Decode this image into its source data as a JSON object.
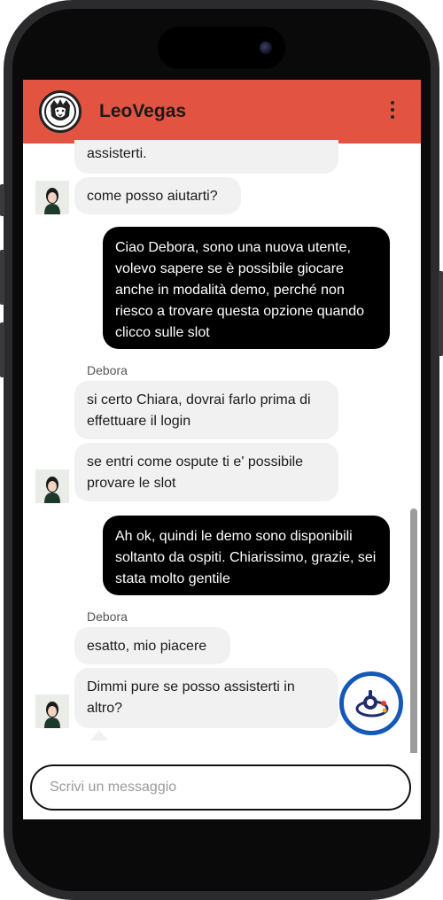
{
  "header": {
    "brand": "LeoVegas",
    "logo_icon": "lion-logo-icon",
    "menu_icon": "kebab-menu-icon",
    "color": "#e25441"
  },
  "messages": [
    {
      "role": "agent",
      "text": "assisterti."
    },
    {
      "role": "agent",
      "text": "come posso aiutarti?"
    },
    {
      "role": "user",
      "text": "Ciao Debora, sono una nuova utente, volevo sapere se è possibile giocare anche in modalità demo, perché non riesco a trovare questa opzione quando clicco sulle slot"
    },
    {
      "role": "sender",
      "text": "Debora"
    },
    {
      "role": "agent",
      "text": "si certo Chiara, dovrai farlo prima di effettuare il login"
    },
    {
      "role": "agent",
      "text": "se entri come ospute ti e' possibile provare le slot"
    },
    {
      "role": "user",
      "text": "Ah ok, quindi le demo sono disponibili soltanto da ospiti. Chiarissimo, grazie, sei stata molto gentile"
    },
    {
      "role": "sender",
      "text": "Debora"
    },
    {
      "role": "agent",
      "text": "esatto, mio piacere"
    },
    {
      "role": "agent",
      "text": "Dimmi pure se posso assisterti in altro?"
    }
  ],
  "input": {
    "placeholder": "Scrivi un messaggio"
  },
  "fab": {
    "icon": "assistant-widget-icon",
    "ring_color": "#1559b8"
  }
}
